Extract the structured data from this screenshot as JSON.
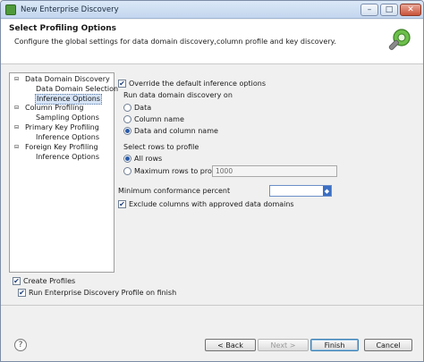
{
  "window": {
    "title": "New Enterprise Discovery",
    "controls": {
      "minimize": "–",
      "maximize": "□",
      "close": "✕"
    }
  },
  "header": {
    "title": "Select Profiling Options",
    "description": "Configure the global settings for data domain discovery,column profile and key discovery.",
    "icon": "wand-settings-icon"
  },
  "tree": {
    "items": [
      {
        "label": "Data Domain Discovery",
        "level": 1,
        "expander": "⊟"
      },
      {
        "label": "Data Domain Selection",
        "level": 2
      },
      {
        "label": "Inference Options",
        "level": 2,
        "selected": true
      },
      {
        "label": "Column Profiling",
        "level": 1,
        "expander": "⊟"
      },
      {
        "label": "Sampling Options",
        "level": 2
      },
      {
        "label": "Primary Key Profiling",
        "level": 1,
        "expander": "⊟"
      },
      {
        "label": "Inference Options",
        "level": 2
      },
      {
        "label": "Foreign Key Profiling",
        "level": 1,
        "expander": "⊟"
      },
      {
        "label": "Inference Options",
        "level": 2
      }
    ]
  },
  "options": {
    "override_label": "Override the default inference options",
    "override_checked": true,
    "run_on_label": "Run data domain discovery on",
    "run_on_choices": [
      "Data",
      "Column name",
      "Data and column name"
    ],
    "run_on_selected": "Data and column name",
    "rows_label": "Select rows to profile",
    "rows_all_label": "All rows",
    "rows_max_label": "Maximum rows to profile",
    "rows_max_value": "1000",
    "rows_selected": "All rows",
    "min_conformance_label": "Minimum conformance percent",
    "min_conformance_value": "",
    "exclude_label": "Exclude columns with approved data domains",
    "exclude_checked": true
  },
  "bottom": {
    "create_profiles_label": "Create Profiles",
    "create_profiles_checked": true,
    "run_profile_label": "Run Enterprise Discovery Profile on finish",
    "run_profile_checked": true
  },
  "buttons": {
    "help": "?",
    "back": "< Back",
    "next": "Next >",
    "finish": "Finish",
    "cancel": "Cancel"
  },
  "colors": {
    "accent": "#2a5ba8",
    "selection": "#d6e4f6"
  }
}
